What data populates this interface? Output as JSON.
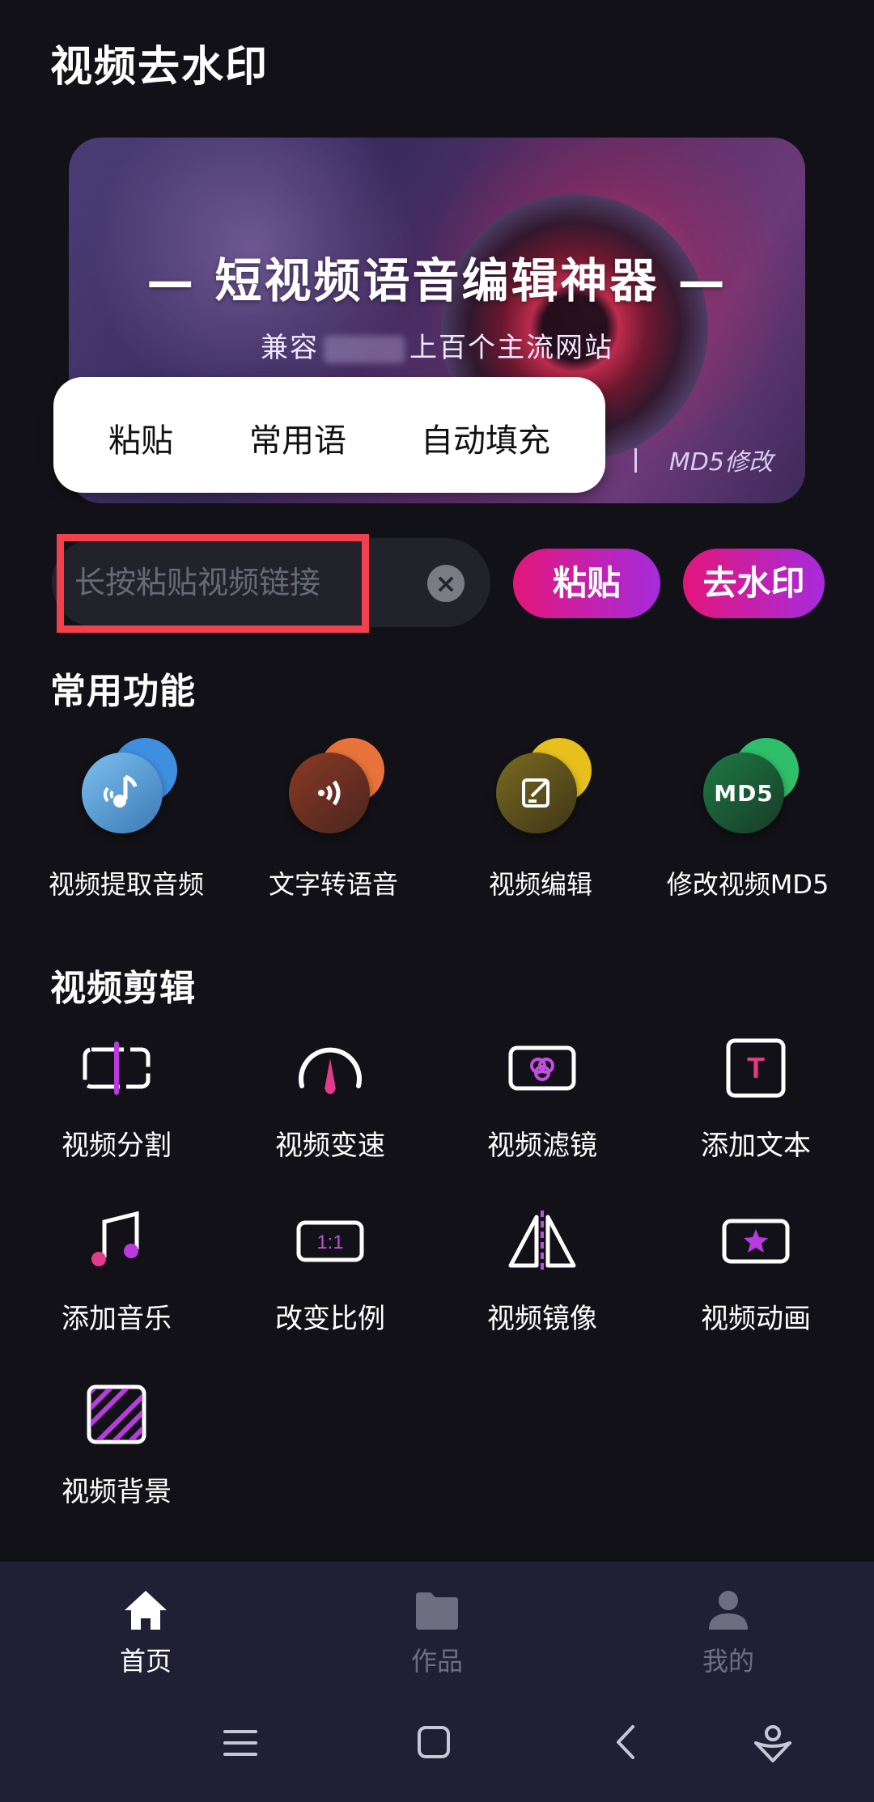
{
  "page": {
    "title": "视频去水印"
  },
  "banner": {
    "title": "— 短视频语音编辑神器 —",
    "subtitle_prefix": "兼容",
    "subtitle_suffix": "上百个主流网站",
    "tag": "MD5修改"
  },
  "popup_menu": {
    "items": [
      "粘贴",
      "常用语",
      "自动填充"
    ]
  },
  "link_input": {
    "placeholder": "长按粘贴视频链接",
    "value": ""
  },
  "buttons": {
    "paste": "粘贴",
    "remove_watermark": "去水印"
  },
  "common": {
    "title": "常用功能",
    "items": [
      {
        "label": "视频提取音频",
        "icon": "audio-extract-icon",
        "color": "#5aa7e6"
      },
      {
        "label": "文字转语音",
        "icon": "text-to-speech-icon",
        "color": "#e8733a"
      },
      {
        "label": "视频编辑",
        "icon": "edit-icon",
        "color": "#e8c01e"
      },
      {
        "label": "修改视频MD5",
        "icon": "md5-icon",
        "color": "#2fbf6a"
      }
    ]
  },
  "editing": {
    "title": "视频剪辑",
    "items": [
      {
        "label": "视频分割",
        "icon": "split-icon"
      },
      {
        "label": "视频变速",
        "icon": "speed-icon"
      },
      {
        "label": "视频滤镜",
        "icon": "filter-icon"
      },
      {
        "label": "添加文本",
        "icon": "text-icon"
      },
      {
        "label": "添加音乐",
        "icon": "music-icon"
      },
      {
        "label": "改变比例",
        "icon": "ratio-icon"
      },
      {
        "label": "视频镜像",
        "icon": "mirror-icon"
      },
      {
        "label": "视频动画",
        "icon": "animation-icon"
      },
      {
        "label": "视频背景",
        "icon": "background-icon"
      }
    ]
  },
  "tabs": [
    {
      "label": "首页",
      "icon": "home-icon",
      "active": true
    },
    {
      "label": "作品",
      "icon": "folder-icon",
      "active": false
    },
    {
      "label": "我的",
      "icon": "profile-icon",
      "active": false
    }
  ],
  "ratio_text": "1:1",
  "text_icon_letter": "T",
  "md5_icon_text": "MD5",
  "colors": {
    "accent_start": "#e3167b",
    "accent_end": "#a62bdc",
    "highlight": "#f2414d",
    "background": "#121117",
    "tabbar": "#211f34"
  }
}
